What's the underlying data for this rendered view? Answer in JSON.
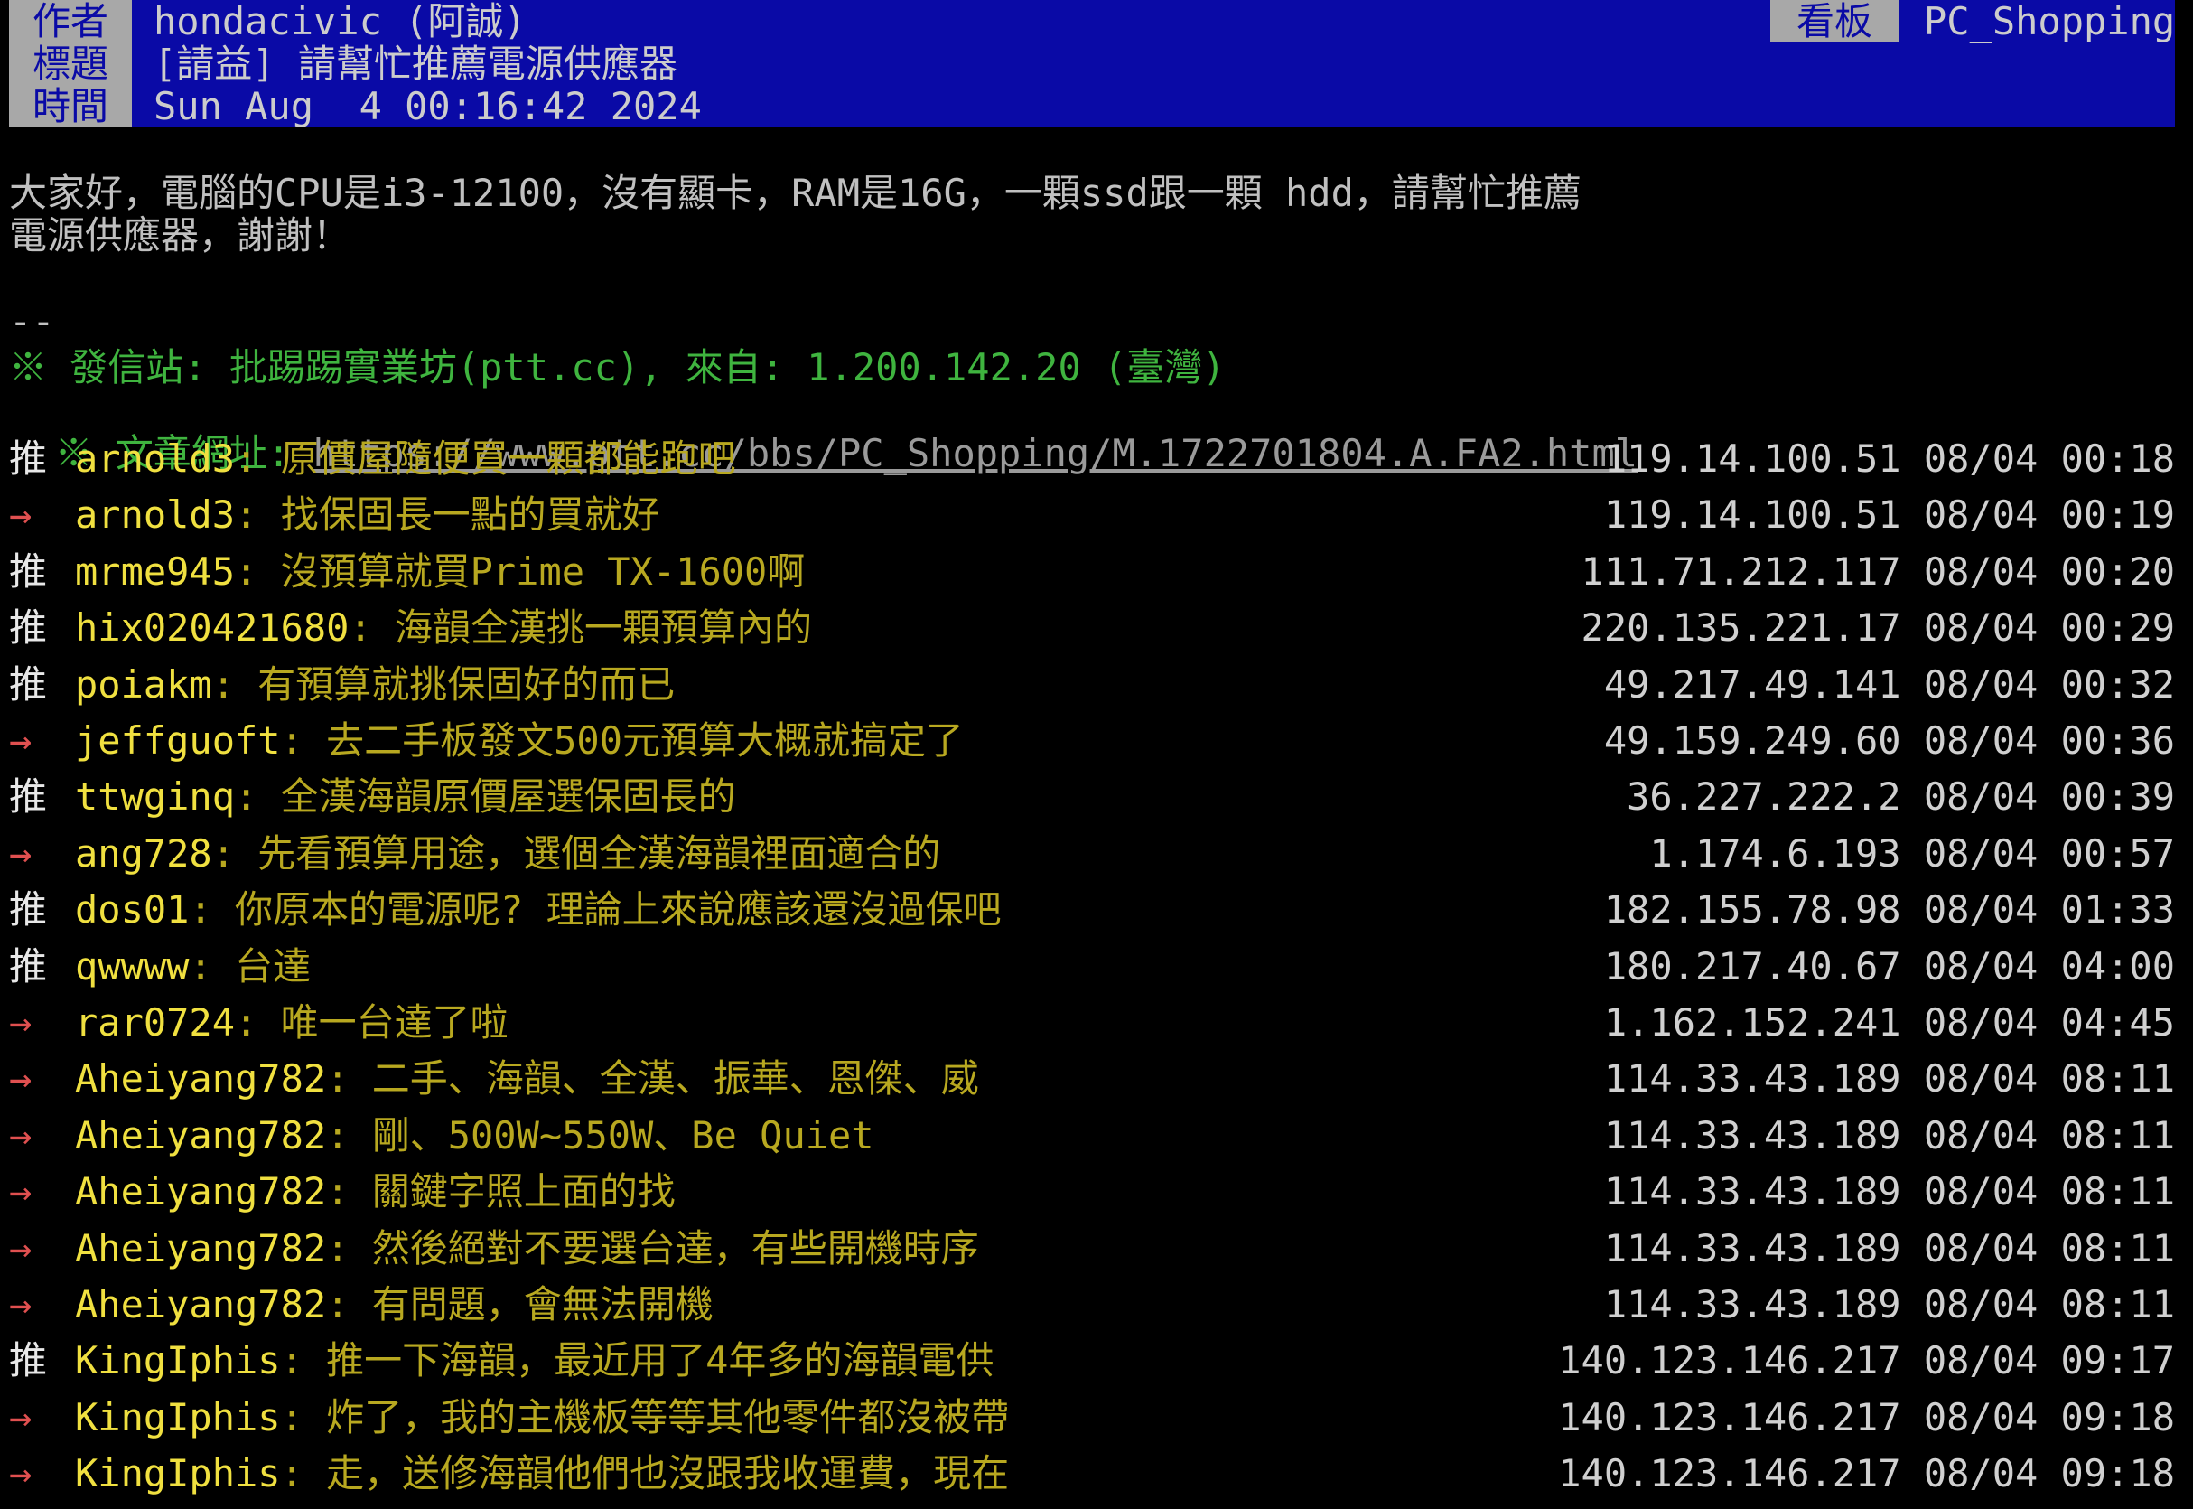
{
  "header": {
    "author_label": "作者",
    "author": "hondacivic (阿誠)",
    "title_label": "標題",
    "title": "[請益] 請幫忙推薦電源供應器",
    "time_label": "時間",
    "time": "Sun Aug  4 00:16:42 2024",
    "board_label": "看板",
    "board": "PC_Shopping"
  },
  "body": {
    "line1": "大家好，電腦的CPU是i3-12100，沒有顯卡，RAM是16G，一顆ssd跟一顆 hdd，請幫忙推薦",
    "line2": "電源供應器，謝謝！",
    "sig": "--"
  },
  "footer": {
    "site": "※ 發信站: 批踢踢實業坊(ptt.cc), 來自: 1.200.142.20 (臺灣)",
    "url_prefix": "※ 文章網址: ",
    "url": "https://www.ptt.cc/bbs/PC_Shopping/M.1722701804.A.FA2.html"
  },
  "pushes": [
    {
      "tag": "推",
      "user": "arnold3",
      "content": "原價屋隨便買一顆都能跑吧",
      "ip": "119.14.100.51",
      "time": "08/04 00:18"
    },
    {
      "tag": "→",
      "user": "arnold3",
      "content": "找保固長一點的買就好",
      "ip": "119.14.100.51",
      "time": "08/04 00:19"
    },
    {
      "tag": "推",
      "user": "mrme945",
      "content": "沒預算就買Prime TX-1600啊",
      "ip": "111.71.212.117",
      "time": "08/04 00:20"
    },
    {
      "tag": "推",
      "user": "hix020421680",
      "content": "海韻全漢挑一顆預算內的",
      "ip": "220.135.221.17",
      "time": "08/04 00:29"
    },
    {
      "tag": "推",
      "user": "poiakm",
      "content": "有預算就挑保固好的而已",
      "ip": "49.217.49.141",
      "time": "08/04 00:32"
    },
    {
      "tag": "→",
      "user": "jeffguoft",
      "content": "去二手板發文500元預算大概就搞定了",
      "ip": "49.159.249.60",
      "time": "08/04 00:36"
    },
    {
      "tag": "推",
      "user": "ttwginq",
      "content": "全漢海韻原價屋選保固長的",
      "ip": "36.227.222.2",
      "time": "08/04 00:39"
    },
    {
      "tag": "→",
      "user": "ang728",
      "content": "先看預算用途，選個全漢海韻裡面適合的",
      "ip": "1.174.6.193",
      "time": "08/04 00:57"
    },
    {
      "tag": "推",
      "user": "dos01",
      "content": "你原本的電源呢? 理論上來說應該還沒過保吧",
      "ip": "182.155.78.98",
      "time": "08/04 01:33"
    },
    {
      "tag": "推",
      "user": "qwwww",
      "content": "台達",
      "ip": "180.217.40.67",
      "time": "08/04 04:00"
    },
    {
      "tag": "→",
      "user": "rar0724",
      "content": "唯一台達了啦",
      "ip": "1.162.152.241",
      "time": "08/04 04:45"
    },
    {
      "tag": "→",
      "user": "Aheiyang782",
      "content": "二手、海韻、全漢、振華、恩傑、威",
      "ip": "114.33.43.189",
      "time": "08/04 08:11"
    },
    {
      "tag": "→",
      "user": "Aheiyang782",
      "content": "剛、500W~550W、Be Quiet",
      "ip": "114.33.43.189",
      "time": "08/04 08:11"
    },
    {
      "tag": "→",
      "user": "Aheiyang782",
      "content": "關鍵字照上面的找",
      "ip": "114.33.43.189",
      "time": "08/04 08:11"
    },
    {
      "tag": "→",
      "user": "Aheiyang782",
      "content": "然後絕對不要選台達，有些開機時序",
      "ip": "114.33.43.189",
      "time": "08/04 08:11"
    },
    {
      "tag": "→",
      "user": "Aheiyang782",
      "content": "有問題，會無法開機",
      "ip": "114.33.43.189",
      "time": "08/04 08:11"
    },
    {
      "tag": "推",
      "user": "KingIphis",
      "content": "推一下海韻，最近用了4年多的海韻電供",
      "ip": "140.123.146.217",
      "time": "08/04 09:17"
    },
    {
      "tag": "→",
      "user": "KingIphis",
      "content": "炸了，我的主機板等等其他零件都沒被帶",
      "ip": "140.123.146.217",
      "time": "08/04 09:18"
    },
    {
      "tag": "→",
      "user": "KingIphis",
      "content": "走，送修海韻他們也沒跟我收運費，現在",
      "ip": "140.123.146.217",
      "time": "08/04 09:18"
    }
  ]
}
